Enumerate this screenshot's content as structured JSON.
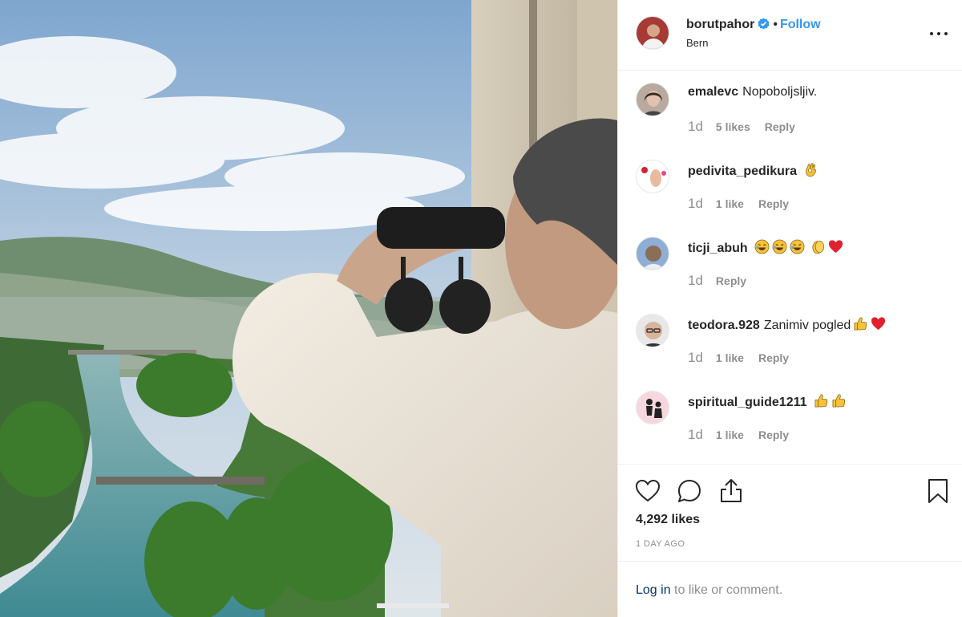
{
  "post": {
    "owner": "borutpahor",
    "verified": true,
    "separator": "•",
    "follow_label": "Follow",
    "location": "Bern",
    "photo_description_icon": "photo"
  },
  "comments": [
    {
      "user": "emalevc",
      "text": "Nopoboljsljiv.",
      "age": "1d",
      "likes": "5 likes",
      "reply": "Reply",
      "emojis": []
    },
    {
      "user": "pedivita_pedikura",
      "text": "",
      "age": "1d",
      "likes": "1 like",
      "reply": "Reply",
      "emojis": [
        "ok-hand"
      ]
    },
    {
      "user": "ticji_abuh",
      "text": "",
      "age": "1d",
      "likes": "",
      "reply": "Reply",
      "emojis": [
        "rofl",
        "rofl",
        "rofl",
        "clap",
        "red-heart"
      ]
    },
    {
      "user": "teodora.928",
      "text": "Zanimiv pogled",
      "age": "1d",
      "likes": "1 like",
      "reply": "Reply",
      "emojis": [
        "thumbs-up",
        "red-heart"
      ]
    },
    {
      "user": "spiritual_guide1211",
      "text": "",
      "age": "1d",
      "likes": "1 like",
      "reply": "Reply",
      "emojis": [
        "thumbs-up",
        "thumbs-up"
      ]
    }
  ],
  "actions": {
    "icons": [
      "heart-icon",
      "comment-icon",
      "share-icon",
      "bookmark-icon"
    ],
    "likes": "4,292 likes",
    "time_ago": "1 DAY AGO"
  },
  "login": {
    "link": "Log in",
    "rest": " to like or comment."
  },
  "colors": {
    "link_blue": "#3897f0",
    "verified_blue": "#3897f0",
    "muted_text": "#8e8e8e",
    "border": "#efefef",
    "heart_red": "#e0202f",
    "emoji_yellow": "#f7c13a"
  }
}
